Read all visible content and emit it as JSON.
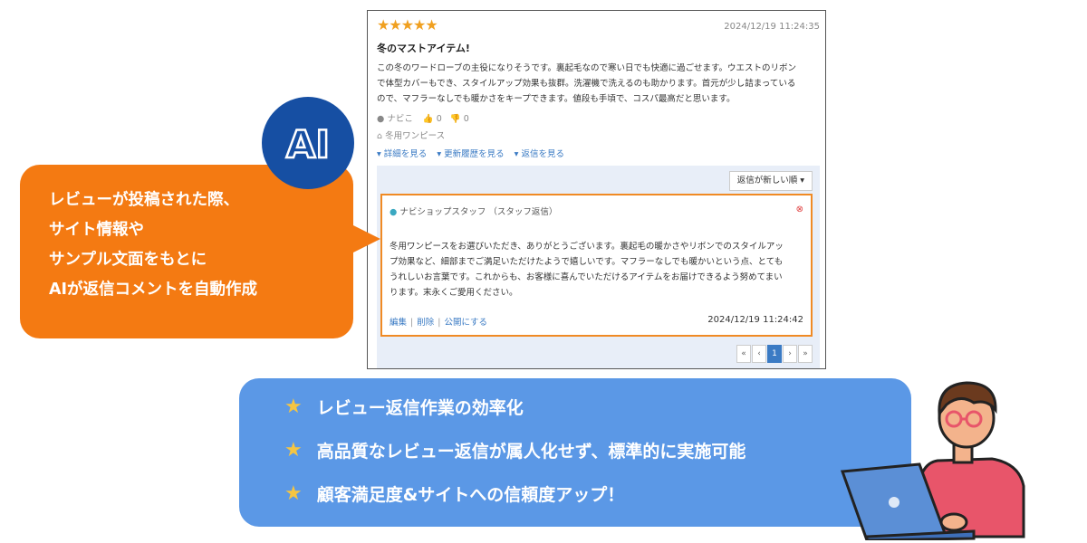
{
  "review": {
    "stars": "★★★★★",
    "date": "2024/12/19 11:24:35",
    "title": "冬のマストアイテム!",
    "body_lines": [
      "この冬のワードローブの主役になりそうです。裏起毛なので寒い日でも快適に過ごせます。ウエストのリボン",
      "で体型カバーもでき、スタイルアップ効果も抜群。洗濯機で洗えるのも助かります。首元が少し詰まっている",
      "ので、マフラーなしでも暖かさをキープできます。値段も手頃で、コスパ最高だと思います。"
    ],
    "user": "ナビこ",
    "likes": "0",
    "dislikes": "0",
    "product": "冬用ワンピース",
    "links": [
      "▾ 詳細を見る",
      "▾ 更新履歴を見る",
      "▾ 返信を見る"
    ]
  },
  "reply": {
    "sort_label": "返信が新しい順 ▾",
    "staff_label": "ナビショップスタッフ （スタッフ返信）",
    "text_lines": [
      "冬用ワンピースをお選びいただき、ありがとうございます。裏起毛の暖かさやリボンでのスタイルアッ",
      "プ効果など、細部までご満足いただけたようで嬉しいです。マフラーなしでも暖かいという点、とても",
      "うれしいお言葉です。これからも、お客様に喜んでいただけるアイテムをお届けできるよう努めてまい",
      "ります。末永くご愛用ください。"
    ],
    "edit": "編集",
    "delete": "削除",
    "publish": "公開にする",
    "date": "2024/12/19 11:24:42"
  },
  "pager": [
    "«",
    "‹",
    "1",
    "›",
    "»"
  ],
  "ai_badge": "AI",
  "callout_lines": [
    "レビューが投稿された際、",
    "サイト情報や",
    "サンプル文面をもとに",
    "AIが返信コメントを自動作成"
  ],
  "benefits": [
    "レビュー返信作業の効率化",
    "高品質なレビュー返信が属人化せず、標準的に実施可能",
    "顧客満足度&サイトへの信頼度アップ！"
  ],
  "colors": {
    "callout": "#f47a12",
    "ai_badge": "#164fa3",
    "benefits_bg": "#5b98e6",
    "star": "#f5c542",
    "reply_border": "#f08a24"
  }
}
